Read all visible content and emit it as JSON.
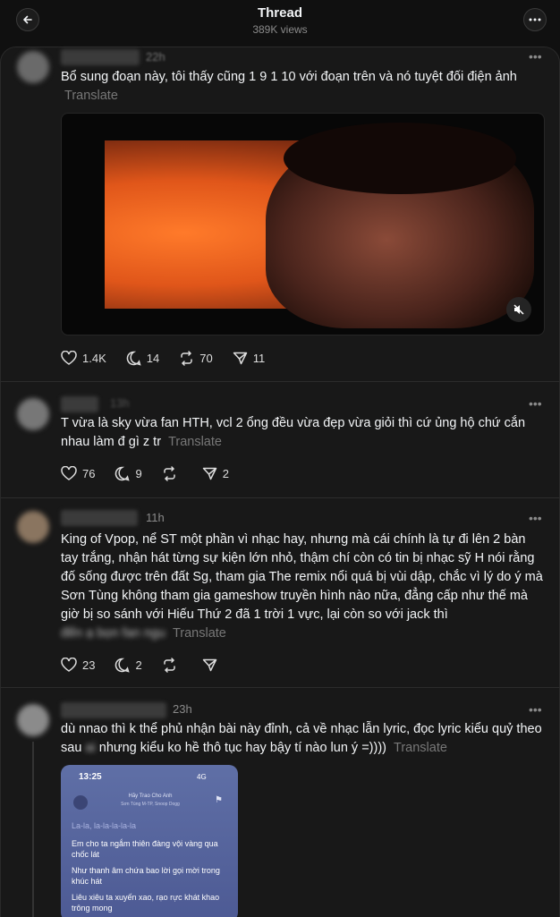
{
  "header": {
    "title": "Thread",
    "views": "389K views"
  },
  "posts": [
    {
      "time": "22h",
      "text": "Bổ sung đoạn này, tôi thấy cũng 1 9 1 10 với đoạn trên và nó tuyệt đối điện ảnh",
      "translate": "Translate",
      "likes": "1.4K",
      "replies": "14",
      "reposts": "70",
      "shares": "11"
    },
    {
      "time": "13h",
      "text": "T vừa là sky vừa fan HTH, vcl 2 ổng đều vừa đẹp vừa giỏi thì cứ ủng hộ chứ cắn nhau làm đ gì z tr",
      "translate": "Translate",
      "likes": "76",
      "replies": "9",
      "reposts": "",
      "shares": "2"
    },
    {
      "time": "11h",
      "text": "King of Vpop, nể ST một phần vì nhạc hay, nhưng mà cái chính là tự đi lên 2 bàn tay trắng, nhận hát từng sự kiện lớn nhỏ, thậm chí còn có tin bị nhạc sỹ H nói rằng đố sống được trên đất Sg, tham gia The remix nổi quá bị vùi dập, chắc vì lý do ý mà Sơn Tùng không tham gia gameshow truyền hình nào nữa, đẳng cấp như thế mà giờ bị so sánh với Hiếu Thứ 2 đã 1 trời 1 vực, lại còn so với jack thì",
      "hidden": "đến ạ bọn fan ngu",
      "translate": "Translate",
      "likes": "23",
      "replies": "2",
      "reposts": "",
      "shares": ""
    },
    {
      "time": "23h",
      "text_a": "dù nnao thì k thể phủ nhận bài này đỉnh, cả về nhạc lẫn lyric, đọc lyric kiểu quỷ theo sau",
      "hidden": "ai",
      "text_b": "nhưng kiểu ko hề thô tục hay bậy tí nào lun ý =))))",
      "translate": "Translate",
      "phone": {
        "clock": "13:25",
        "status": "4G",
        "song": "Hãy Trao Cho Anh",
        "artist": "Sơn Tùng M-TP, Snoop Dogg",
        "lyrics": [
          "La-la, la-la-la-la-la",
          "Em cho ta ngắm thiên đàng vội vàng qua chốc lát",
          "Như thanh âm chứa bao lời gọi mời trong khúc hát",
          "Liêu xiêu ta xuyến xao, rạo rực khát khao trông mong"
        ]
      }
    }
  ],
  "colors": {
    "background": "#101010",
    "panel": "#181818",
    "muted": "#777777",
    "text": "#f3f5f7"
  }
}
